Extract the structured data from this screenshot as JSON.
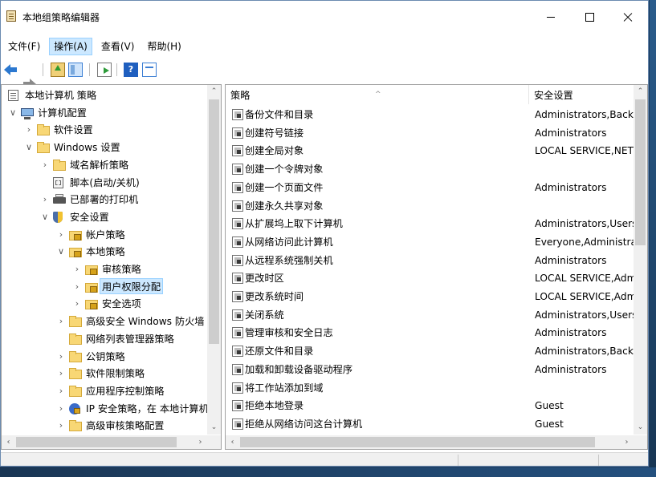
{
  "window": {
    "title": "本地组策略编辑器"
  },
  "menu": [
    {
      "label": "文件(F)",
      "active": false
    },
    {
      "label": "操作(A)",
      "active": true
    },
    {
      "label": "查看(V)",
      "active": false
    },
    {
      "label": "帮助(H)",
      "active": false
    }
  ],
  "toolbar": {
    "help_glyph": "?"
  },
  "icons": {
    "back": "back-arrow-icon",
    "forward": "forward-arrow-icon",
    "up": "up-folder-icon",
    "show_hide": "show-hide-tree-icon",
    "export": "export-list-icon",
    "help": "help-icon",
    "properties": "properties-icon"
  },
  "tree": [
    {
      "label": "本地计算机 策略",
      "icon": "policy-doc",
      "twisty": ""
    },
    {
      "label": "计算机配置",
      "icon": "computer",
      "twisty": "∨"
    },
    {
      "label": "软件设置",
      "icon": "folder",
      "twisty": "›"
    },
    {
      "label": "Windows 设置",
      "icon": "folder",
      "twisty": "∨"
    },
    {
      "label": "域名解析策略",
      "icon": "folder",
      "twisty": "›"
    },
    {
      "label": "脚本(启动/关机)",
      "icon": "script",
      "twisty": ""
    },
    {
      "label": "已部署的打印机",
      "icon": "printer",
      "twisty": "›"
    },
    {
      "label": "安全设置",
      "icon": "shield",
      "twisty": "∨"
    },
    {
      "label": "帐户策略",
      "icon": "lockfolder",
      "twisty": "›"
    },
    {
      "label": "本地策略",
      "icon": "lockfolder",
      "twisty": "∨"
    },
    {
      "label": "审核策略",
      "icon": "lockfolder",
      "twisty": "›"
    },
    {
      "label": "用户权限分配",
      "icon": "lockfolder",
      "twisty": "›",
      "selected": true
    },
    {
      "label": "安全选项",
      "icon": "lockfolder",
      "twisty": "›"
    },
    {
      "label": "高级安全 Windows 防火墙",
      "icon": "folder",
      "twisty": "›"
    },
    {
      "label": "网络列表管理器策略",
      "icon": "folder",
      "twisty": ""
    },
    {
      "label": "公钥策略",
      "icon": "folder",
      "twisty": "›"
    },
    {
      "label": "软件限制策略",
      "icon": "folder",
      "twisty": "›"
    },
    {
      "label": "应用程序控制策略",
      "icon": "folder",
      "twisty": "›"
    },
    {
      "label": "IP 安全策略，在 本地计算机",
      "icon": "ipsec",
      "twisty": "›"
    },
    {
      "label": "高级审核策略配置",
      "icon": "folder",
      "twisty": "›"
    }
  ],
  "list": {
    "columns": [
      "策略",
      "安全设置"
    ],
    "sort_caret": "^",
    "rows": [
      {
        "name": "备份文件和目录",
        "value": "Administrators,Backup Operators"
      },
      {
        "name": "创建符号链接",
        "value": "Administrators"
      },
      {
        "name": "创建全局对象",
        "value": "LOCAL SERVICE,NETWORK SERVICE"
      },
      {
        "name": "创建一个令牌对象",
        "value": ""
      },
      {
        "name": "创建一个页面文件",
        "value": "Administrators"
      },
      {
        "name": "创建永久共享对象",
        "value": ""
      },
      {
        "name": "从扩展坞上取下计算机",
        "value": "Administrators,Users"
      },
      {
        "name": "从网络访问此计算机",
        "value": "Everyone,Administrators"
      },
      {
        "name": "从远程系统强制关机",
        "value": "Administrators"
      },
      {
        "name": "更改时区",
        "value": "LOCAL SERVICE,Administrators"
      },
      {
        "name": "更改系统时间",
        "value": "LOCAL SERVICE,Administrators"
      },
      {
        "name": "关闭系统",
        "value": "Administrators,Users"
      },
      {
        "name": "管理审核和安全日志",
        "value": "Administrators"
      },
      {
        "name": "还原文件和目录",
        "value": "Administrators,Backup Operators"
      },
      {
        "name": "加载和卸载设备驱动程序",
        "value": "Administrators"
      },
      {
        "name": "将工作站添加到域",
        "value": ""
      },
      {
        "name": "拒绝本地登录",
        "value": "Guest"
      },
      {
        "name": "拒绝从网络访问这台计算机",
        "value": "Guest"
      }
    ]
  },
  "scroll_glyphs": {
    "up": "⌃",
    "down": "⌄",
    "left": "‹",
    "right": "›"
  }
}
